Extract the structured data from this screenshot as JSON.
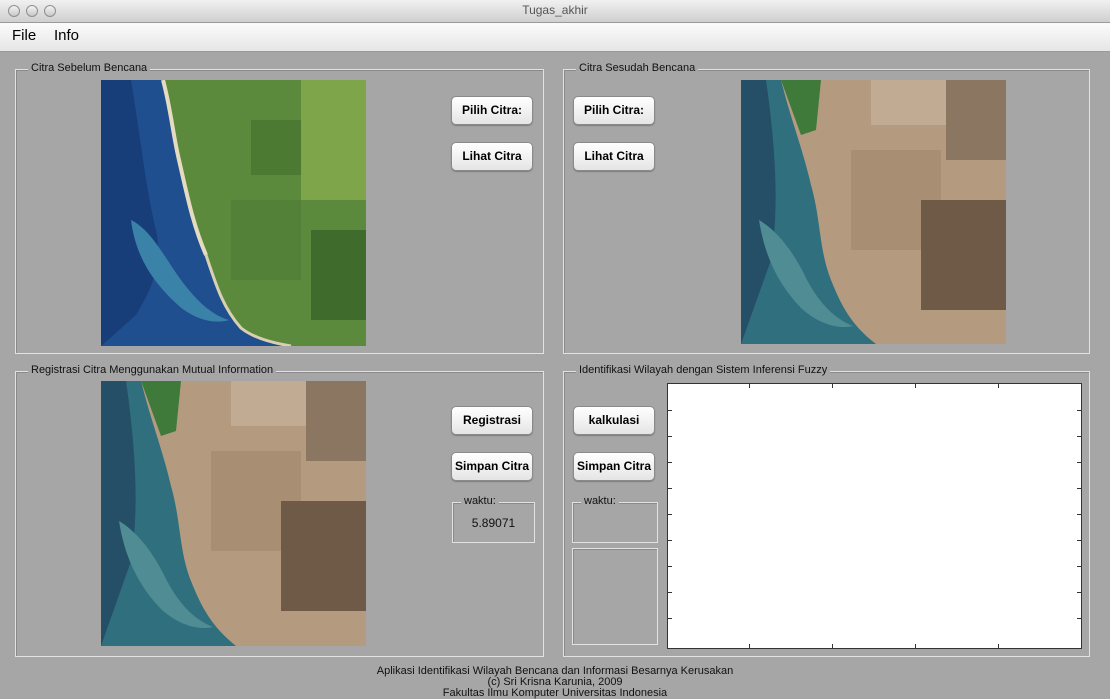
{
  "window": {
    "title": "Tugas_akhir"
  },
  "menu": {
    "file": "File",
    "info": "Info"
  },
  "panels": {
    "before": {
      "title": "Citra Sebelum Bencana",
      "pick_button": "Pilih Citra:",
      "view_button": "Lihat Citra"
    },
    "after": {
      "title": "Citra Sesudah Bencana",
      "pick_button": "Pilih Citra:",
      "view_button": "Lihat Citra"
    },
    "registration": {
      "title": "Registrasi Citra Menggunakan Mutual Information",
      "register_button": "Registrasi",
      "save_button": "Simpan Citra",
      "time_label": "waktu:",
      "time_value": "5.89071"
    },
    "fuzzy": {
      "title": "Identifikasi Wilayah dengan Sistem Inferensi Fuzzy",
      "calc_button": "kalkulasi",
      "save_button": "Simpan Citra",
      "time_label": "waktu:",
      "time_value": ""
    }
  },
  "footer": {
    "line1": "Aplikasi Identifikasi Wilayah Bencana dan Informasi Besarnya Kerusakan",
    "line2": "(c) Sri Krisna Karunia, 2009",
    "line3": "Fakultas Ilmu Komputer Universitas Indonesia"
  },
  "colors": {
    "window_bg": "#a6a6a6",
    "plot_bg": "#ffffff"
  }
}
